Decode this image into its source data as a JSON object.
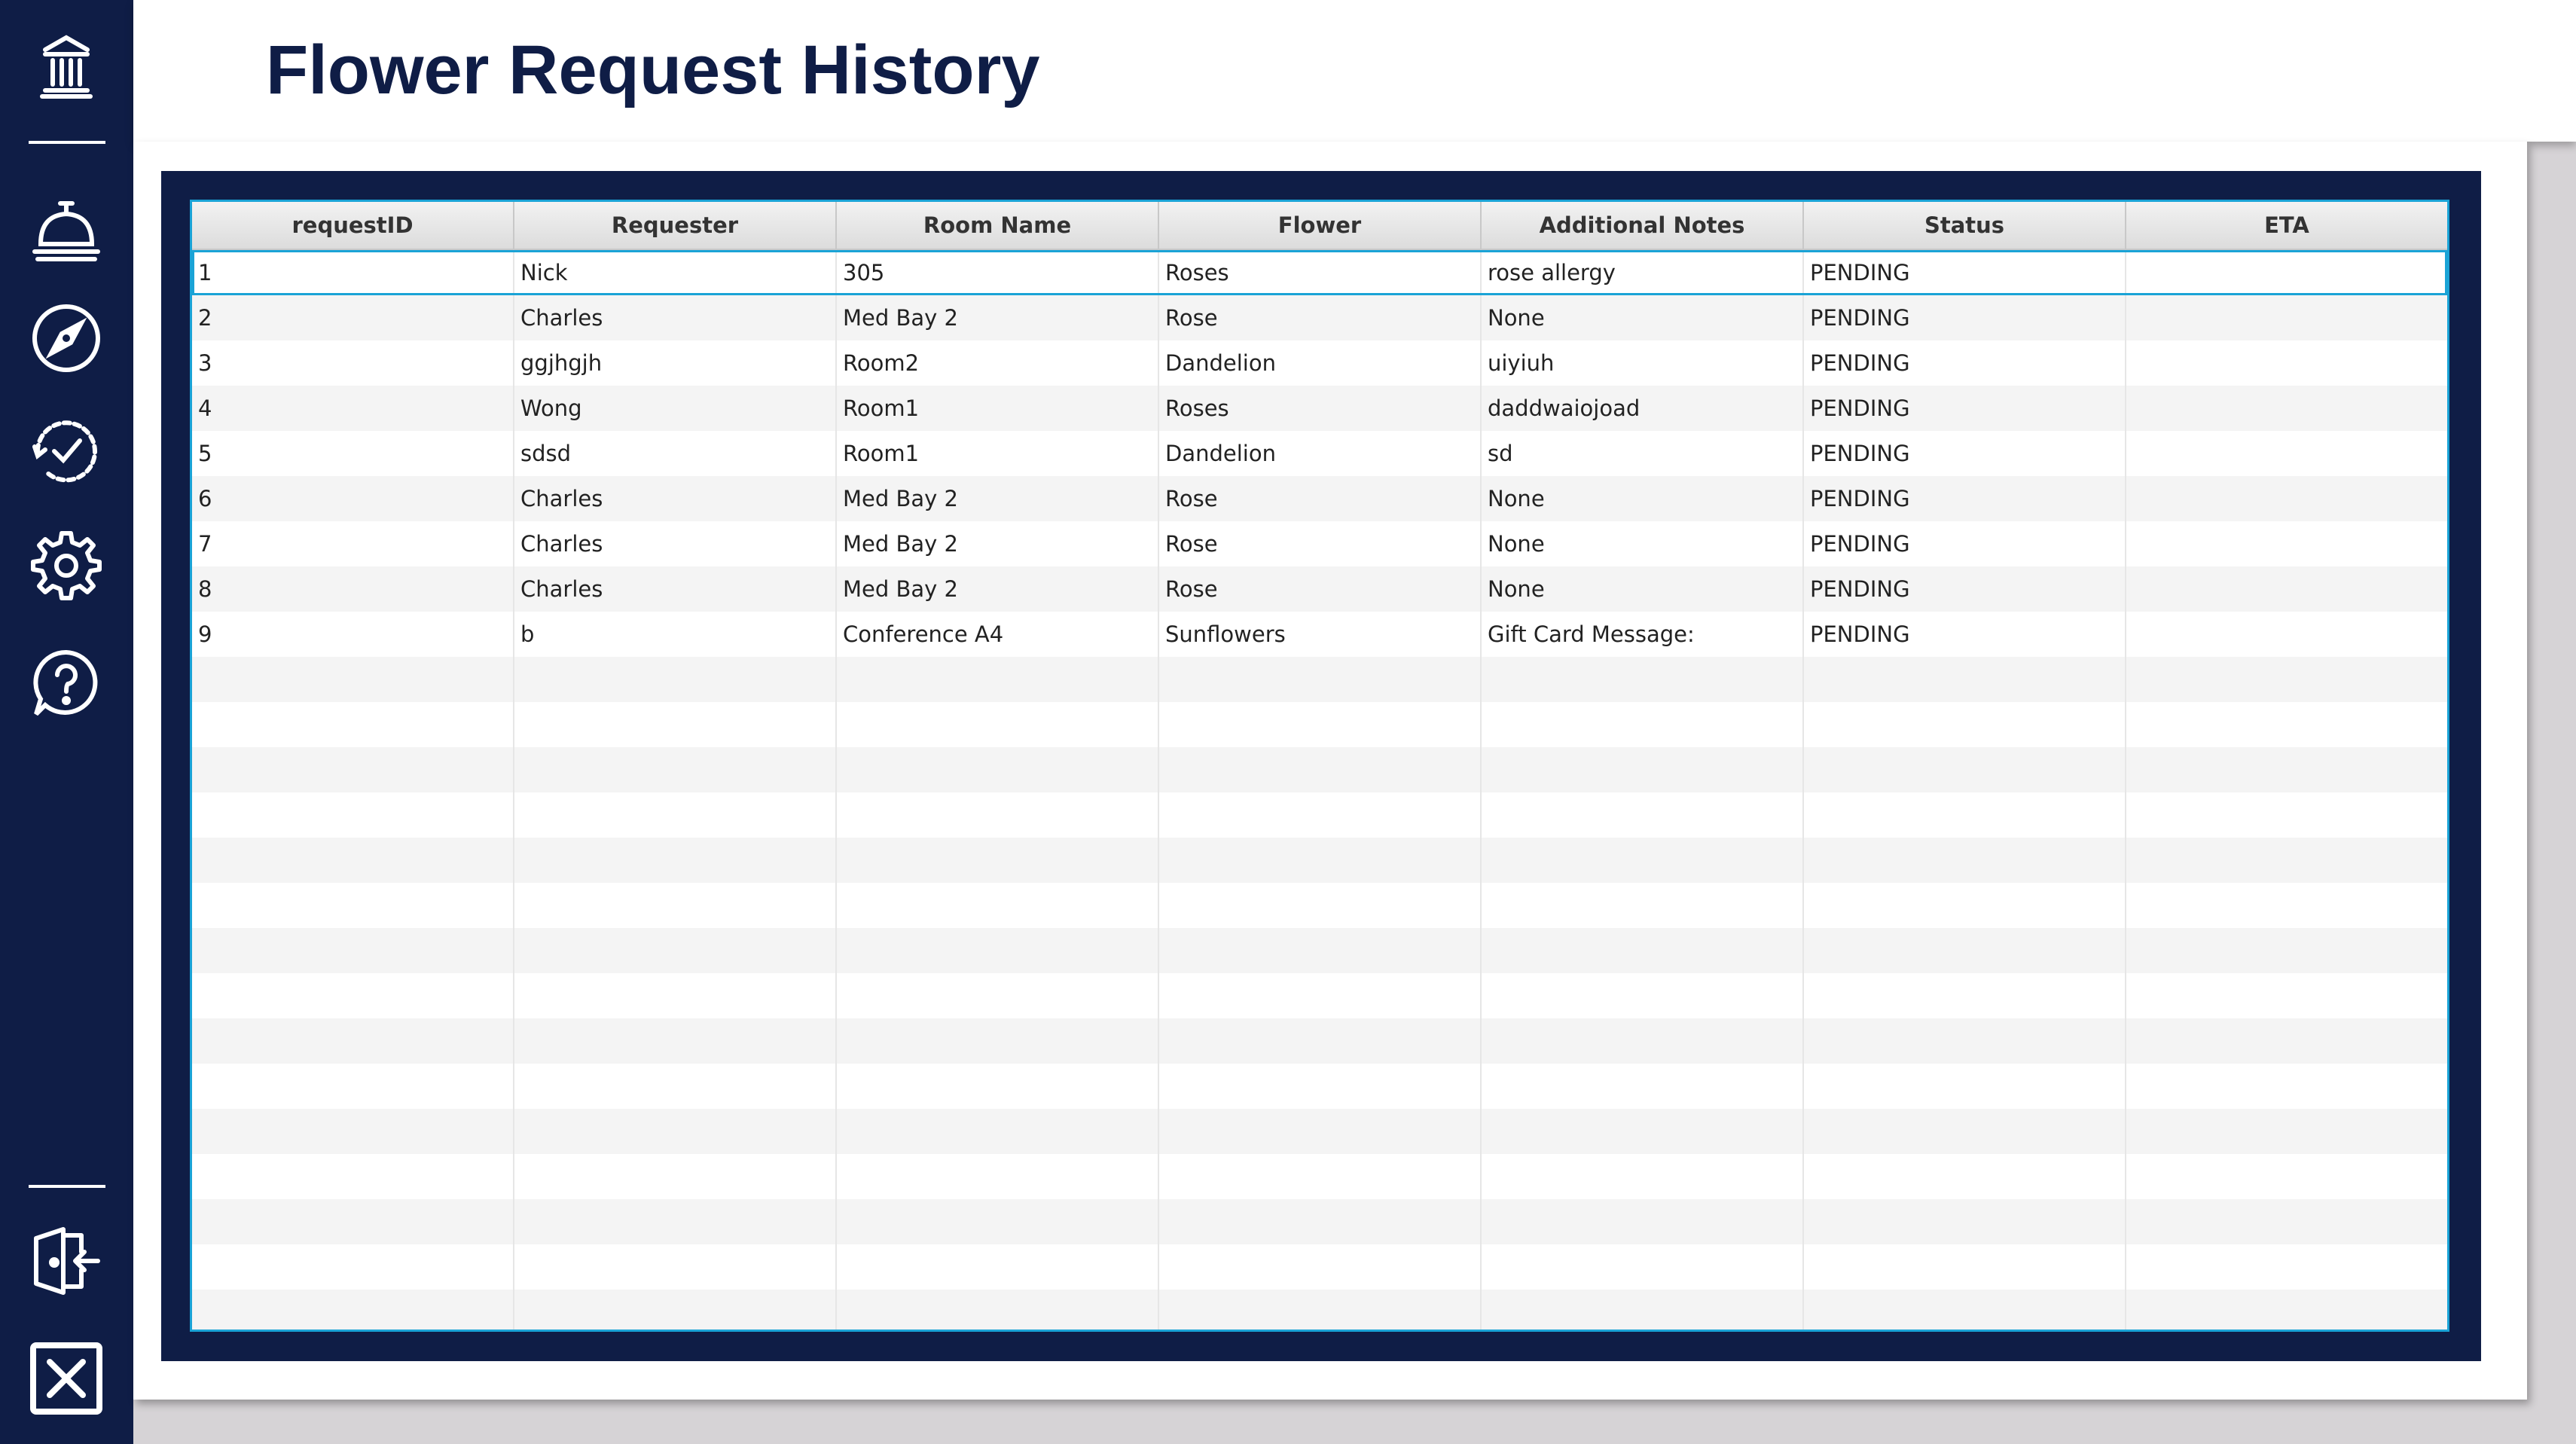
{
  "page": {
    "title": "Flower Request History"
  },
  "sidebar": {
    "icons": [
      "building-icon",
      "service-bell-icon",
      "compass-icon",
      "history-check-icon",
      "gear-icon",
      "help-icon",
      "logout-icon",
      "close-icon"
    ],
    "color": "#0f1d46"
  },
  "table": {
    "columns": [
      "requestID",
      "Requester",
      "Room Name",
      "Flower",
      "Additional Notes",
      "Status",
      "ETA"
    ],
    "rows": [
      [
        "1",
        "Nick",
        "305",
        "Roses",
        "rose allergy",
        "PENDING",
        ""
      ],
      [
        "2",
        "Charles",
        "Med Bay 2",
        "Rose",
        "None",
        "PENDING",
        ""
      ],
      [
        "3",
        "ggjhgjh",
        "Room2",
        "Dandelion",
        "uiyiuh",
        "PENDING",
        ""
      ],
      [
        "4",
        "Wong",
        "Room1",
        "Roses",
        "daddwaiojoad",
        "PENDING",
        ""
      ],
      [
        "5",
        "sdsd",
        "Room1",
        "Dandelion",
        "sd",
        "PENDING",
        ""
      ],
      [
        "6",
        "Charles",
        "Med Bay 2",
        "Rose",
        "None",
        "PENDING",
        ""
      ],
      [
        "7",
        "Charles",
        "Med Bay 2",
        "Rose",
        "None",
        "PENDING",
        ""
      ],
      [
        "8",
        "Charles",
        "Med Bay 2",
        "Rose",
        "None",
        "PENDING",
        ""
      ],
      [
        "9",
        "b",
        "Conference A4",
        "Sunflowers",
        "Gift Card Message:",
        "PENDING",
        ""
      ]
    ],
    "selected_row": 0,
    "empty_rows": 15,
    "accent_color": "#1aa3d6"
  }
}
